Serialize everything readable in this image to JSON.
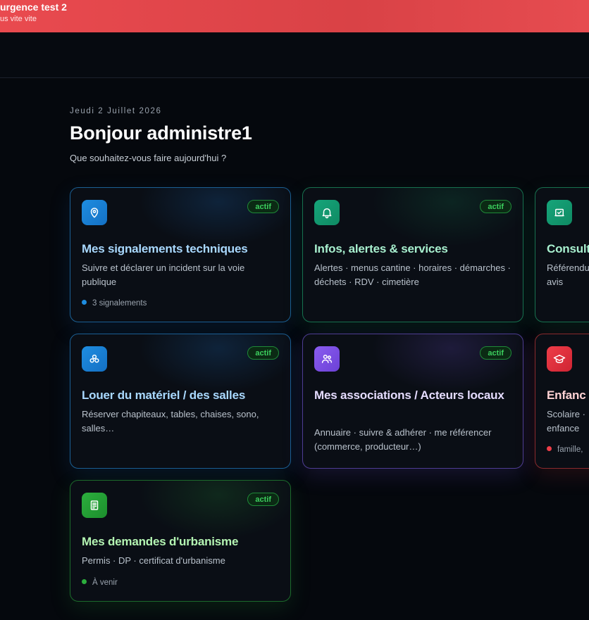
{
  "alert": {
    "title": "urgence test 2",
    "text": "us vite vite"
  },
  "greeting": {
    "date": "Jeudi 2 Juillet 2026",
    "title": "Bonjour administre1",
    "subtitle": "Que souhaitez-vous faire aujourd'hui ?"
  },
  "cards": [
    {
      "title": "Mes signalements techniques",
      "description": "Suivre et déclarer un incident sur la voie publique",
      "badge": "actif",
      "meta": "3 signalements",
      "icon": "map-pin-icon",
      "accent": "#1e8de0"
    },
    {
      "title": "Infos, alertes & services",
      "description": "Alertes · menus cantine · horaires · démarches · déchets · RDV · cimetière",
      "badge": "actif",
      "icon": "bell-icon",
      "accent": "#16a57a"
    },
    {
      "title": "Consult",
      "description": "Référendu avis",
      "icon": "vote-icon",
      "accent": "#16a57a"
    },
    {
      "title": "Louer du matériel / des salles",
      "description": "Réserver chapiteaux, tables, chaises, sono, salles…",
      "badge": "actif",
      "icon": "boxes-icon",
      "accent": "#1e8de0"
    },
    {
      "title": "Mes associations / Acteurs locaux",
      "description": "Annuaire · suivre & adhérer · me référencer (commerce, producteur…)",
      "badge": "actif",
      "icon": "users-icon",
      "accent": "#8a5cf0"
    },
    {
      "title": "Enfanc",
      "description": "Scolaire · enfance",
      "meta": "famille,",
      "icon": "graduation-cap-icon",
      "accent": "#ee3d48"
    },
    {
      "title": "Mes demandes d'urbanisme",
      "description": "Permis · DP · certificat d'urbanisme",
      "badge": "actif",
      "meta": "À venir",
      "icon": "building-document-icon",
      "accent": "#2cae3d"
    }
  ]
}
